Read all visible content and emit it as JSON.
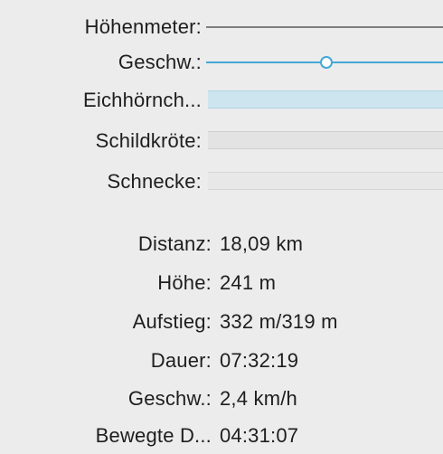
{
  "legend": {
    "elevation_label": "Höhenmeter:",
    "speed_label": "Geschw.:",
    "squirrel_label": "Eichhörnch...",
    "turtle_label": "Schildkröte:",
    "snail_label": "Schnecke:",
    "colors": {
      "elevation": "#7d7d7d",
      "speed": "#46a7d6",
      "squirrel": "#cde5ef",
      "turtle": "#e3e3e3",
      "snail": "#e8e8e8"
    }
  },
  "stats": {
    "distance_label": "Distanz:",
    "distance_value": "18,09 km",
    "altitude_label": "Höhe:",
    "altitude_value": "241 m",
    "ascent_label": "Aufstieg:",
    "ascent_value": "332 m/319 m",
    "duration_label": "Dauer:",
    "duration_value": "07:32:19",
    "speed_label": "Geschw.:",
    "speed_value": "2,4 km/h",
    "moving_label": "Bewegte D...",
    "moving_value": "04:31:07"
  }
}
